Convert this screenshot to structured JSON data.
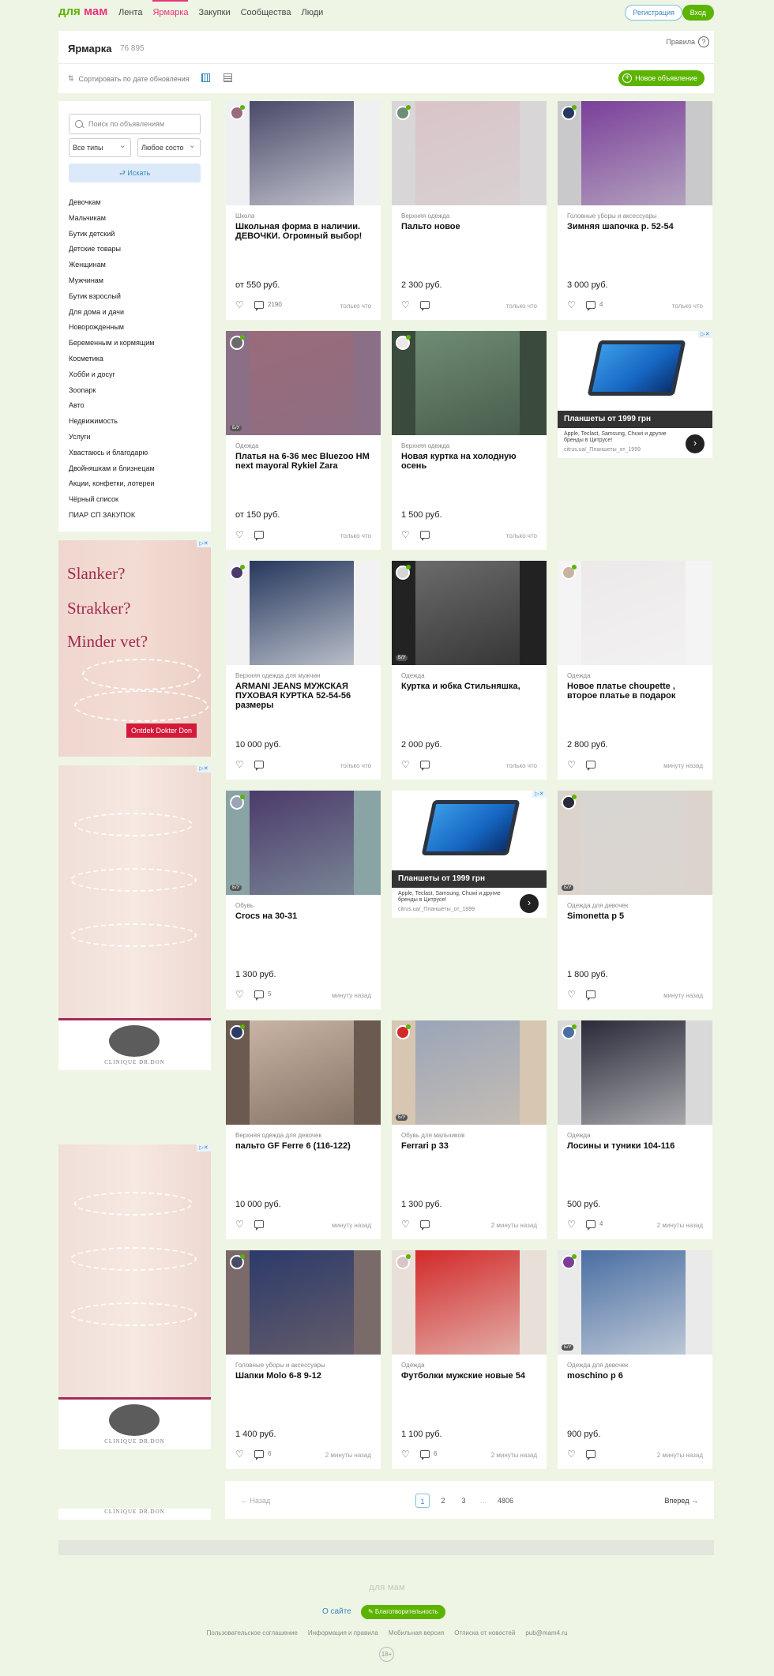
{
  "brand": {
    "logo_a": "для",
    "logo_b": "мам",
    "green": "#5cb300",
    "pink": "#e8337a",
    "blue": "#3a88c0"
  },
  "nav": [
    "Лента",
    "Ярмарка",
    "Закупки",
    "Сообщества",
    "Люди"
  ],
  "auth": {
    "register": "Регистрация",
    "login": "Вход"
  },
  "header": {
    "title": "Ярмарка",
    "count": "76 895",
    "rules": "Правила",
    "sort": "Сортировать по дате обновления",
    "new_ad": "Новое объявление"
  },
  "filters": {
    "search_placeholder": "Поиск по объявлениям",
    "type": "Все типы",
    "condition": "Любое состо",
    "find": "⮐ Искать"
  },
  "categories": [
    "Девочкам",
    "Мальчикам",
    "Бутик детский",
    "Детские товары",
    "Женщинам",
    "Мужчинам",
    "Бутик взрослый",
    "Для дома и дачи",
    "Новорожденным",
    "Беременным и кормящим",
    "Косметика",
    "Хобби и досуг",
    "Зоопарк",
    "Авто",
    "Недвижимость",
    "Услуги",
    "Хвастаюсь и благодарю",
    "Двойняшкам и близнецам",
    "Акции, конфетки, лотереи",
    "Чёрный список",
    "ПИАР СП ЗАКУПОК"
  ],
  "side_ad": {
    "line1": "Slanker?",
    "line2": "Strakker?",
    "line3": "Minder vet?",
    "button": "Ontdek Dokter Don",
    "brand": "CLINIQUE DR.DON"
  },
  "grid_ad": {
    "title": "Планшеты от 1999 грн",
    "text": "Apple, Teclast, Samsung, Chuwi и другие бренды в Цитрусе!",
    "url": "citrus.ua/_Планшеты_от_1999"
  },
  "cards": [
    {
      "cat": "Школа",
      "title": "Школьная форма в наличии. ДЕВОЧКИ. Огромный выбор!",
      "price": "от 550 руб.",
      "comments": "2190",
      "time": "только что",
      "bu": ""
    },
    {
      "cat": "Верхняя одежда",
      "title": "Пальто новое",
      "price": "2 300 руб.",
      "comments": "",
      "time": "только что",
      "bu": ""
    },
    {
      "cat": "Головные уборы и аксессуары",
      "title": "Зимняя шапочка р. 52-54",
      "price": "3 000 руб.",
      "comments": "4",
      "time": "только что",
      "bu": ""
    },
    {
      "cat": "Одежда",
      "title": "Платья на 6-36 мес Bluezoo HM next mayoral Rykiel Zara",
      "price": "от 150 руб.",
      "comments": "",
      "time": "только что",
      "bu": "Б/У"
    },
    {
      "cat": "Верхняя одежда",
      "title": "Новая куртка на холодную осень",
      "price": "1 500 руб.",
      "comments": "",
      "time": "только что",
      "bu": ""
    },
    {
      "cat": "Верхняя одежда для мужчин",
      "title": "ARMANI JEANS МУЖСКАЯ ПУХОВАЯ КУРТКА 52-54-56 размеры",
      "price": "10 000 руб.",
      "comments": "",
      "time": "только что",
      "bu": ""
    },
    {
      "cat": "Одежда",
      "title": "Куртка и юбка Стильняшка,",
      "price": "2 000 руб.",
      "comments": "",
      "time": "только что",
      "bu": "Б/У"
    },
    {
      "cat": "Одежда",
      "title": "Новое платье choupette , второе платье в подарок",
      "price": "2 800 руб.",
      "comments": "",
      "time": "минуту назад",
      "bu": ""
    },
    {
      "cat": "Обувь",
      "title": "Crocs на 30-31",
      "price": "1 300 руб.",
      "comments": "5",
      "time": "минуту назад",
      "bu": "Б/У"
    },
    {
      "cat": "Одежда для девочек",
      "title": "Simonetta р 5",
      "price": "1 800 руб.",
      "comments": "",
      "time": "минуту назад",
      "bu": "Б/У"
    },
    {
      "cat": "Верхняя одежда для девочек",
      "title": "пальто GF Ferre 6 (116-122)",
      "price": "10 000 руб.",
      "comments": "",
      "time": "минуту назад",
      "bu": ""
    },
    {
      "cat": "Обувь для мальчиков",
      "title": "Ferrari р 33",
      "price": "1 300 руб.",
      "comments": "",
      "time": "2 минуты назад",
      "bu": "Б/У"
    },
    {
      "cat": "Одежда",
      "title": "Лосины и туники 104-116",
      "price": "500 руб.",
      "comments": "4",
      "time": "2 минуты назад",
      "bu": ""
    },
    {
      "cat": "Головные уборы и аксессуары",
      "title": "Шапки Molo 6-8 9-12",
      "price": "1 400 руб.",
      "comments": "6",
      "time": "2 минуты назад",
      "bu": ""
    },
    {
      "cat": "Одежда",
      "title": "Футболки мужские новые 54",
      "price": "1 100 руб.",
      "comments": "6",
      "time": "2 минуты назад",
      "bu": ""
    },
    {
      "cat": "Одежда для девочек",
      "title": "moschino р 6",
      "price": "900 руб.",
      "comments": "",
      "time": "2 минуты назад",
      "bu": "Б/У"
    }
  ],
  "pager": {
    "prev": "← Назад",
    "next": "Вперед →",
    "p1": "1",
    "p2": "2",
    "p3": "3",
    "dots": "...",
    "last": "4806"
  },
  "footer": {
    "logo": "для мам",
    "about": "О сайте",
    "charity": "✎ Благотворительность",
    "links": [
      "Пользовательское соглашение",
      "Информация и правила",
      "Мобильная версия",
      "Отписка от новостей",
      "pub@mam4.ru"
    ],
    "age": "18+"
  }
}
